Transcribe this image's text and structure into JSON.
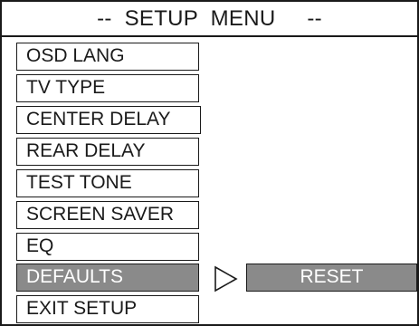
{
  "window": {
    "title": "--  SETUP  MENU     --"
  },
  "menu": {
    "items": [
      {
        "label": "OSD LANG",
        "selected": false
      },
      {
        "label": "TV TYPE",
        "selected": false
      },
      {
        "label": "CENTER DELAY",
        "selected": false
      },
      {
        "label": "REAR DELAY",
        "selected": false
      },
      {
        "label": "TEST TONE",
        "selected": false
      },
      {
        "label": "SCREEN SAVER",
        "selected": false
      },
      {
        "label": "EQ",
        "selected": false
      },
      {
        "label": "DEFAULTS",
        "selected": true
      },
      {
        "label": "EXIT SETUP",
        "selected": false
      }
    ]
  },
  "submenu": {
    "arrow_icon": "triangle-right-icon",
    "option_label": "RESET"
  },
  "colors": {
    "border": "#1a1a1a",
    "background": "#ffffff",
    "highlight": "#8a8a8a",
    "highlight_text": "#ffffff"
  }
}
